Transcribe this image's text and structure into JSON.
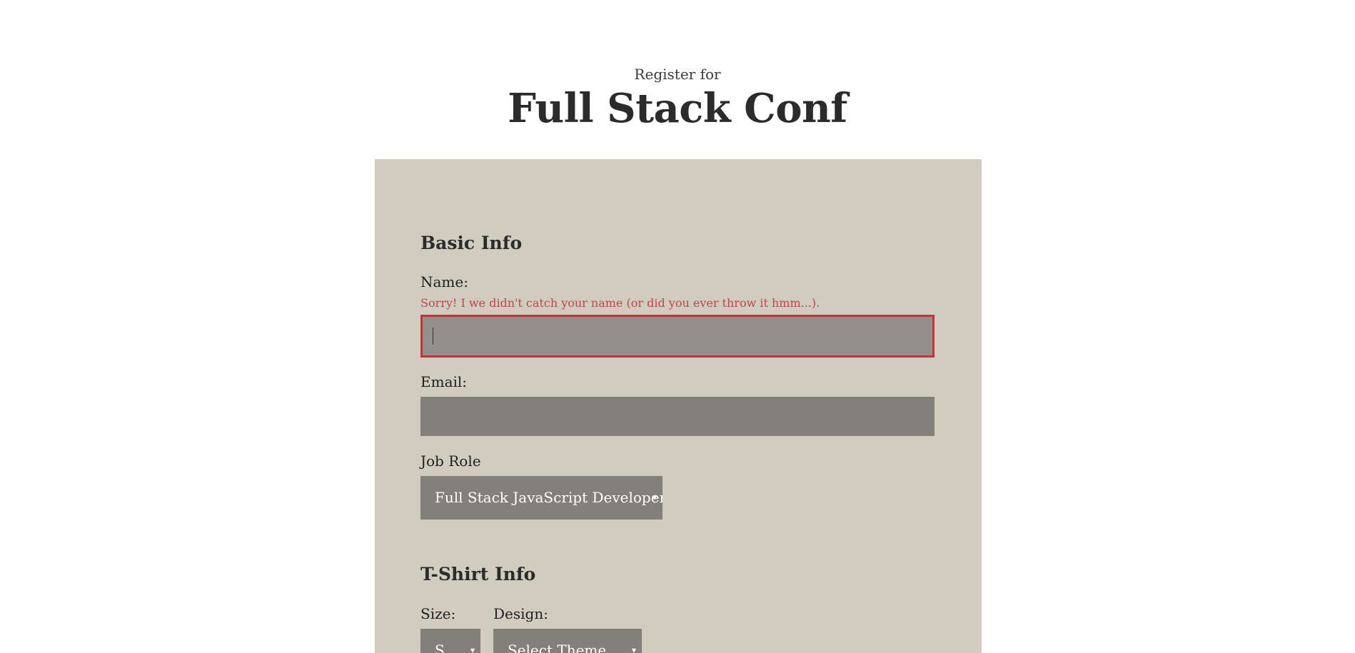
{
  "header": {
    "pre_title": "Register for",
    "title": "Full Stack Conf"
  },
  "basic_info": {
    "heading": "Basic Info",
    "name_label": "Name:",
    "name_error": "Sorry! I we didn't catch your name (or did you ever throw it hmm...).",
    "name_value": "",
    "email_label": "Email:",
    "email_value": "",
    "job_role_label": "Job Role",
    "job_role_selected": "Full Stack JavaScript Developer"
  },
  "tshirt_info": {
    "heading": "T-Shirt Info",
    "size_label": "Size:",
    "size_selected": "S",
    "design_label": "Design:",
    "design_selected": "Select Theme"
  },
  "icons": {
    "dropdown_arrow": "▾"
  },
  "colors": {
    "panel_bg": "#d0ccc0",
    "input_bg": "#83807a",
    "error": "#c0343c"
  }
}
